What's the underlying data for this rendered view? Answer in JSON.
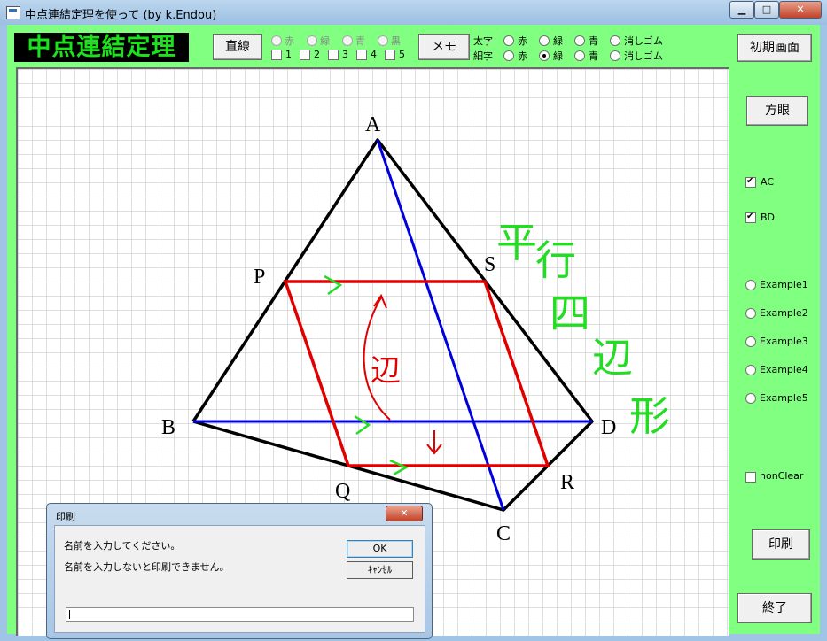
{
  "window": {
    "title": "中点連結定理を使って (by k.Endou)"
  },
  "titlebar_buttons": {
    "minimize": "▁",
    "maximize": "□",
    "close": "✕"
  },
  "toolbar": {
    "logo": "中点連結定理",
    "line_button": "直線",
    "line_colors": [
      "赤",
      "緑",
      "青",
      "黒"
    ],
    "line_numbers": [
      "1",
      "2",
      "3",
      "4",
      "5"
    ],
    "memo_button": "メモ",
    "thick_label": "太字",
    "thin_label": "細字",
    "pen_options": [
      "赤",
      "緑",
      "青",
      "消しゴム"
    ],
    "reset_button": "初期画面"
  },
  "sidebar": {
    "grid_button": "方眼",
    "checks": [
      {
        "label": "AC",
        "checked": true
      },
      {
        "label": "BD",
        "checked": true
      }
    ],
    "examples": [
      "Example1",
      "Example2",
      "Example3",
      "Example4",
      "Example5"
    ],
    "nonclear_label": "nonClear",
    "print_button": "印刷",
    "exit_button": "終了"
  },
  "figure": {
    "labels": {
      "A": "A",
      "B": "B",
      "C": "C",
      "D": "D",
      "P": "P",
      "Q": "Q",
      "R": "R",
      "S": "S"
    },
    "annotation": "平行四辺形",
    "annotation_mid": "辺"
  },
  "dialog": {
    "title": "印刷",
    "close": "✕",
    "message1": "名前を入力してください。",
    "message2": "名前を入力しないと印刷できません。",
    "ok_button": "OK",
    "cancel_button": "ｷｬﾝｾﾙ",
    "input_value": ""
  },
  "colors": {
    "accent_green": "#80ff80",
    "logo_text": "#1ee11e",
    "triangle": "#000000",
    "parallelogram": "#e00000",
    "diagonal": "#0000dd",
    "annotation": "#22dd22"
  }
}
